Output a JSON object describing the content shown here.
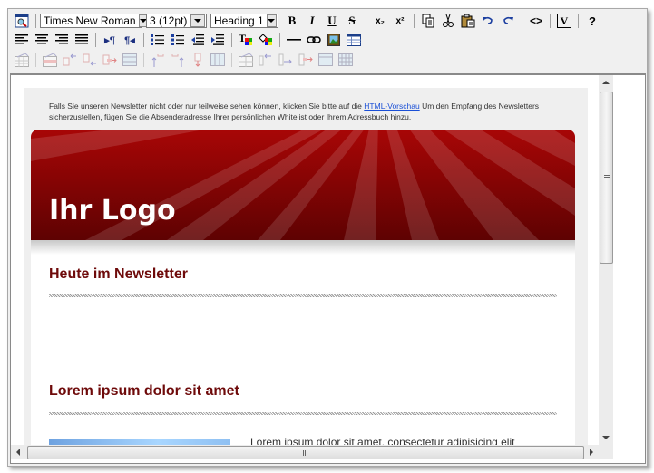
{
  "toolbar": {
    "row1": {
      "preview_label": "Preview",
      "font_family": "Times New Roman",
      "font_size": "3 (12pt)",
      "block_format": "Heading 1",
      "bold": "B",
      "italic": "I",
      "underline": "U",
      "strikethrough": "S",
      "subscript": "x₂",
      "superscript": "x²",
      "copy": "copy",
      "cut": "cut",
      "paste": "paste",
      "undo": "undo",
      "redo": "redo",
      "source": "<>",
      "validate": "V",
      "help": "?"
    },
    "row2": {
      "align_left": "align-left",
      "align_center": "align-center",
      "align_right": "align-right",
      "justify": "justify",
      "ltr": "ltr",
      "rtl": "rtl",
      "ordered_list": "ordered-list",
      "unordered_list": "unordered-list",
      "outdent": "outdent",
      "indent": "indent",
      "text_color": "text-color",
      "bg_color": "background-color",
      "horizontal_rule": "horizontal-rule",
      "link": "link",
      "image": "image",
      "table": "table"
    },
    "row3_disabled": true
  },
  "document": {
    "preheader_text_1": "Falls Sie unseren Newsletter nicht oder nur teilweise sehen können, klicken Sie bitte auf die ",
    "preheader_link": "HTML-Vorschau",
    "preheader_text_2": " Um den Empfang des Newsletters sicherzustellen, fügen Sie die Absenderadresse Ihrer persönlichen Whitelist oder Ihrem Adressbuch hinzu.",
    "logo_text": "Ihr Logo",
    "section1_title": "Heute im Newsletter",
    "section2_title": "Lorem ipsum dolor sit amet",
    "body_text": "Lorem ipsum dolor sit amet, consectetur adipisicing elit"
  },
  "colors": {
    "banner_top": "#a80606",
    "banner_bottom": "#5e0202",
    "section_title": "#6e0a0a",
    "link": "#1a4fd6"
  }
}
